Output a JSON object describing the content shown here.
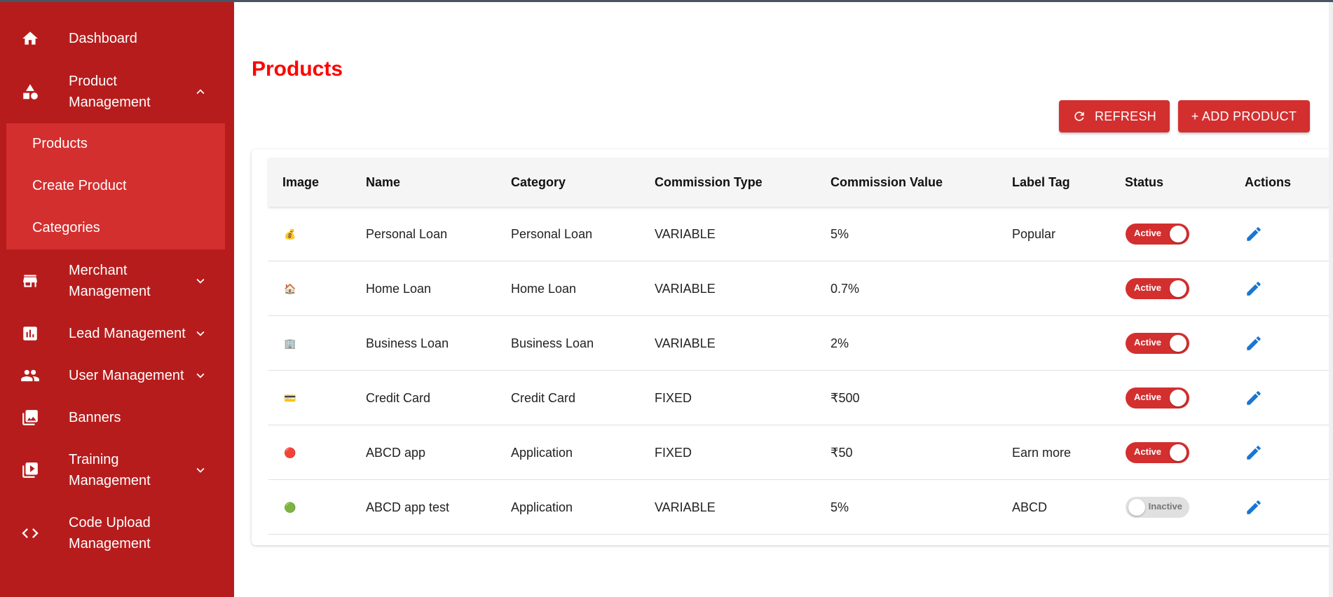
{
  "sidebar": {
    "items": [
      {
        "label": "Dashboard",
        "icon": "home-icon"
      },
      {
        "label": "Product Management",
        "icon": "shapes-icon",
        "expanded": true
      },
      {
        "label": "Merchant Management",
        "icon": "store-icon"
      },
      {
        "label": "Lead Management",
        "icon": "chart-icon"
      },
      {
        "label": "User Management",
        "icon": "people-icon"
      },
      {
        "label": "Banners",
        "icon": "images-icon"
      },
      {
        "label": "Training Management",
        "icon": "video-library-icon"
      },
      {
        "label": "Code Upload Management",
        "icon": "code-icon"
      }
    ],
    "submenu": [
      "Products",
      "Create Product",
      "Categories"
    ]
  },
  "page": {
    "title": "Products",
    "refresh_label": "REFRESH",
    "add_label": "+ ADD PRODUCT"
  },
  "table": {
    "headers": [
      "Image",
      "Name",
      "Category",
      "Commission Type",
      "Commission Value",
      "Label Tag",
      "Status",
      "Actions"
    ],
    "rows": [
      {
        "image": "💰",
        "name": "Personal Loan",
        "category": "Personal Loan",
        "type": "VARIABLE",
        "value": "5%",
        "tag": "Popular",
        "status": "Active",
        "active": true
      },
      {
        "image": "🏠",
        "name": "Home Loan",
        "category": "Home Loan",
        "type": "VARIABLE",
        "value": "0.7%",
        "tag": "",
        "status": "Active",
        "active": true
      },
      {
        "image": "🏢",
        "name": "Business Loan",
        "category": "Business Loan",
        "type": "VARIABLE",
        "value": "2%",
        "tag": "",
        "status": "Active",
        "active": true
      },
      {
        "image": "💳",
        "name": "Credit Card",
        "category": "Credit Card",
        "type": "FIXED",
        "value": "₹500",
        "tag": "",
        "status": "Active",
        "active": true
      },
      {
        "image": "🔴",
        "name": "ABCD app",
        "category": "Application",
        "type": "FIXED",
        "value": "₹50",
        "tag": "Earn more",
        "status": "Active",
        "active": true
      },
      {
        "image": "🟢",
        "name": "ABCD app test",
        "category": "Application",
        "type": "VARIABLE",
        "value": "5%",
        "tag": "ABCD",
        "status": "Inactive",
        "active": false
      }
    ]
  },
  "colors": {
    "sidebar_bg": "#b71c1c",
    "submenu_bg": "#d32f2f",
    "accent": "#d32f2f",
    "title": "#ff0000",
    "edit_icon": "#1976d2"
  }
}
